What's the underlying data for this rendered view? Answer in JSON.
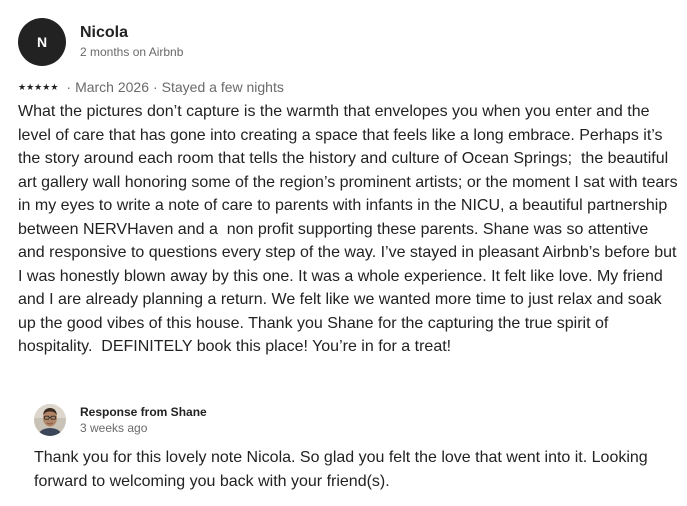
{
  "review": {
    "avatar_initial": "N",
    "name": "Nicola",
    "tenure": "2 months on Airbnb",
    "rating": 5,
    "date": "March 2026",
    "stay": "Stayed a few nights",
    "text": "What the pictures don’t capture is the warmth that envelopes you when you enter and the level of care that has gone into creating a space that feels like a long embrace. Perhaps it’s the story around each room that tells the history and culture of Ocean Springs;  the beautiful art gallery wall honoring some of the region’s prominent artists; or the moment I sat with tears in my eyes to write a note of care to parents with infants in the NICU, a beautiful partnership between NERVHaven and a  non profit supporting these parents. Shane was so attentive and responsive to questions every step of the way. I’ve stayed in pleasant Airbnb’s before but I was honestly blown away by this one. It was a whole experience. It felt like love. My friend and I are already planning a return. We felt like we wanted more time to just relax and soak up the good vibes of this house. Thank you Shane for the capturing the true spirit of hospitality.  DEFINITELY book this place! You’re in for a treat!"
  },
  "response": {
    "title": "Response from Shane",
    "time": "3 weeks ago",
    "text": "Thank you for this lovely note Nicola. So glad you felt the love that went into it. Looking forward to welcoming you back with your friend(s)."
  },
  "icons": {
    "star": "star-icon",
    "host_avatar": "host-avatar"
  },
  "colors": {
    "text": "#222222",
    "secondary": "#6a6a6a",
    "avatar_bg": "#222222"
  },
  "separators": {
    "dot": "·"
  }
}
